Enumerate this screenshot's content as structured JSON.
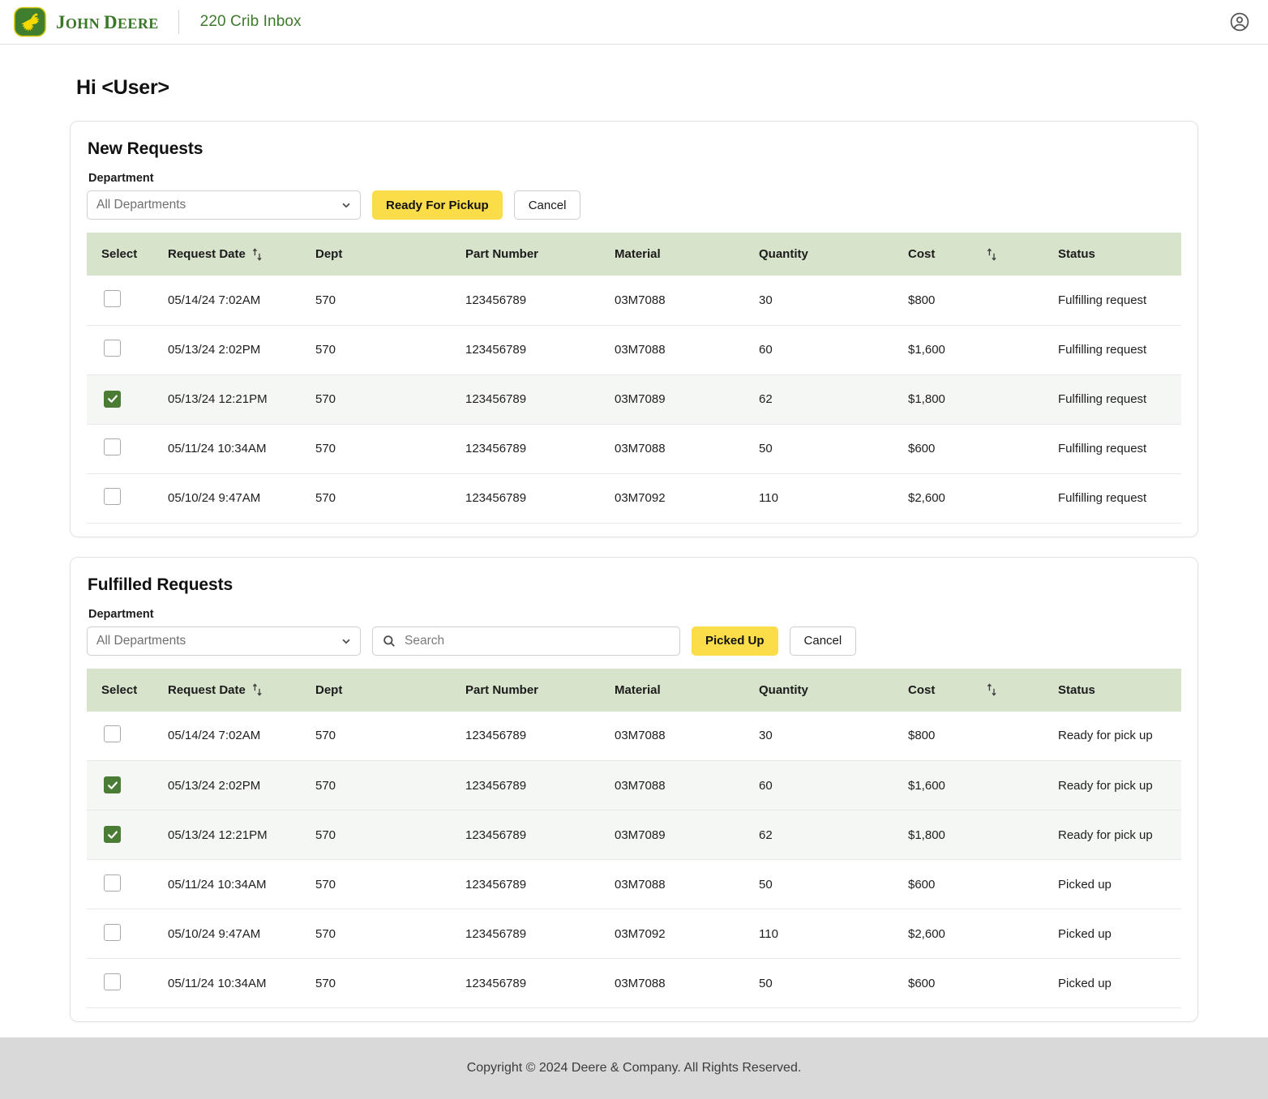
{
  "header": {
    "brand_word_1": "J",
    "brand_word": "OHN ",
    "brand_word_2": "D",
    "brand_word_3": "EERE",
    "app_title": "220 Crib Inbox",
    "account_icon": "account-circle-icon"
  },
  "greeting": "Hi <User>",
  "colors": {
    "brand_green": "#3a7728",
    "accent_yellow": "#fbdd4a",
    "table_header_green": "#d8e3cb",
    "checkbox_green": "#4a7c36",
    "footer_gray": "#d9d9d9"
  },
  "new_requests": {
    "title": "New Requests",
    "department_label": "Department",
    "department_value": "All Departments",
    "primary_button": "Ready For Pickup",
    "cancel_button": "Cancel",
    "columns": [
      "Select",
      "Request Date",
      "Dept",
      "Part Number",
      "Material",
      "Quantity",
      "Cost",
      "Status"
    ],
    "rows": [
      {
        "selected": false,
        "date": "05/14/24 7:02AM",
        "dept": "570",
        "part": "123456789",
        "material": "03M7088",
        "qty": "30",
        "cost": "$800",
        "status": "Fulfilling request"
      },
      {
        "selected": false,
        "date": "05/13/24 2:02PM",
        "dept": "570",
        "part": "123456789",
        "material": "03M7088",
        "qty": "60",
        "cost": "$1,600",
        "status": "Fulfilling request"
      },
      {
        "selected": true,
        "date": "05/13/24 12:21PM",
        "dept": "570",
        "part": "123456789",
        "material": "03M7089",
        "qty": "62",
        "cost": "$1,800",
        "status": "Fulfilling request"
      },
      {
        "selected": false,
        "date": "05/11/24 10:34AM",
        "dept": "570",
        "part": "123456789",
        "material": "03M7088",
        "qty": "50",
        "cost": "$600",
        "status": "Fulfilling request"
      },
      {
        "selected": false,
        "date": "05/10/24 9:47AM",
        "dept": "570",
        "part": "123456789",
        "material": "03M7092",
        "qty": "110",
        "cost": "$2,600",
        "status": "Fulfilling request"
      }
    ]
  },
  "fulfilled_requests": {
    "title": "Fulfilled Requests",
    "department_label": "Department",
    "department_value": "All Departments",
    "search_placeholder": "Search",
    "search_value": "",
    "primary_button": "Picked Up",
    "cancel_button": "Cancel",
    "columns": [
      "Select",
      "Request Date",
      "Dept",
      "Part Number",
      "Material",
      "Quantity",
      "Cost",
      "Status"
    ],
    "rows": [
      {
        "selected": false,
        "date": "05/14/24 7:02AM",
        "dept": "570",
        "part": "123456789",
        "material": "03M7088",
        "qty": "30",
        "cost": "$800",
        "status": "Ready for pick up"
      },
      {
        "selected": true,
        "date": "05/13/24 2:02PM",
        "dept": "570",
        "part": "123456789",
        "material": "03M7088",
        "qty": "60",
        "cost": "$1,600",
        "status": "Ready for pick up"
      },
      {
        "selected": true,
        "date": "05/13/24 12:21PM",
        "dept": "570",
        "part": "123456789",
        "material": "03M7089",
        "qty": "62",
        "cost": "$1,800",
        "status": "Ready for pick up"
      },
      {
        "selected": false,
        "date": "05/11/24 10:34AM",
        "dept": "570",
        "part": "123456789",
        "material": "03M7088",
        "qty": "50",
        "cost": "$600",
        "status": "Picked up"
      },
      {
        "selected": false,
        "date": "05/10/24 9:47AM",
        "dept": "570",
        "part": "123456789",
        "material": "03M7092",
        "qty": "110",
        "cost": "$2,600",
        "status": "Picked up"
      },
      {
        "selected": false,
        "date": "05/11/24 10:34AM",
        "dept": "570",
        "part": "123456789",
        "material": "03M7088",
        "qty": "50",
        "cost": "$600",
        "status": "Picked up"
      }
    ]
  },
  "footer": {
    "copyright": "Copyright © 2024 Deere & Company. All Rights Reserved."
  }
}
